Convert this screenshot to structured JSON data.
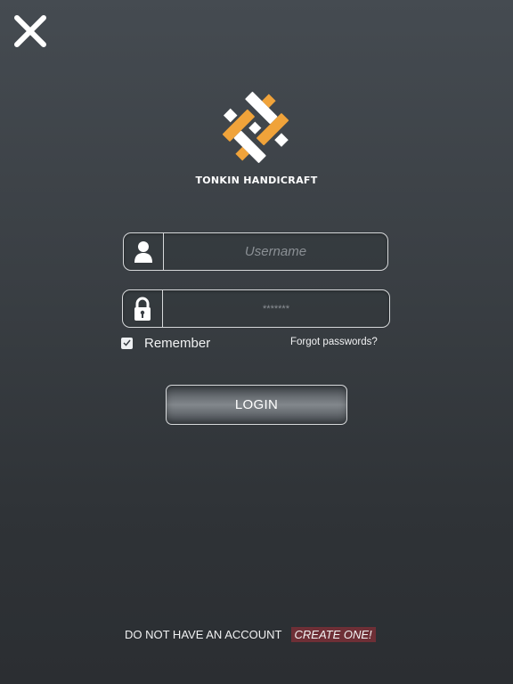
{
  "header": {
    "close_icon": "close-icon"
  },
  "brand": {
    "name": "TONKIN HANDICRAFT",
    "logo_colors": [
      "#f0a33a",
      "#ffffff"
    ]
  },
  "form": {
    "username": {
      "icon": "user-icon",
      "placeholder": "Username",
      "value": ""
    },
    "password": {
      "icon": "lock-icon",
      "value": "*******"
    },
    "remember": {
      "label": "Remember",
      "checked": true
    },
    "forgot_label": "Forgot passwords?",
    "login_label": "LOGIN"
  },
  "footer": {
    "prompt": "DO NOT HAVE AN ACCOUNT",
    "create_label": "CREATE ONE!",
    "create_color": "#6e2f36"
  }
}
